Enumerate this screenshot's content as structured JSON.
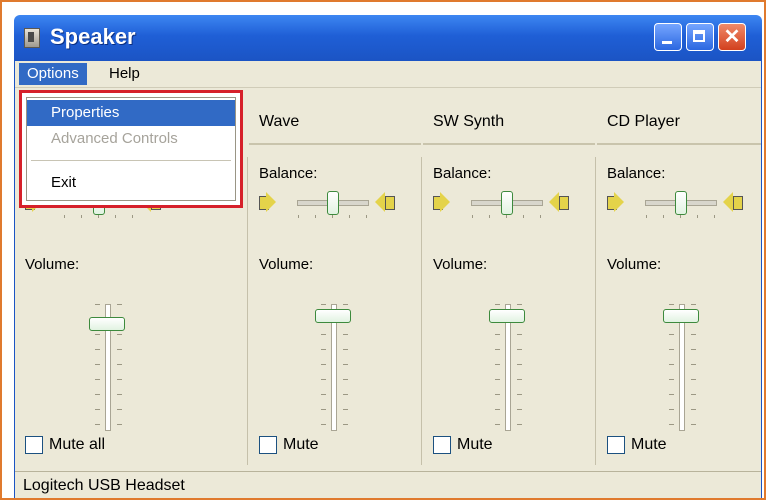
{
  "window": {
    "title": "Speaker"
  },
  "menubar": {
    "items": [
      "Options",
      "Help"
    ]
  },
  "dropdown": {
    "items": [
      {
        "label": "Properties",
        "state": "highlighted"
      },
      {
        "label": "Advanced Controls",
        "state": "disabled"
      },
      {
        "label": "Exit",
        "state": "normal"
      }
    ]
  },
  "columns": [
    {
      "title": "",
      "balance_label": "",
      "volume_label": "Volume:",
      "mute_label": "Mute all",
      "balance": 0.5,
      "volume": 0.9
    },
    {
      "title": "Wave",
      "balance_label": "Balance:",
      "volume_label": "Volume:",
      "mute_label": "Mute",
      "balance": 0.5,
      "volume": 0.96
    },
    {
      "title": "SW Synth",
      "balance_label": "Balance:",
      "volume_label": "Volume:",
      "mute_label": "Mute",
      "balance": 0.5,
      "volume": 0.96
    },
    {
      "title": "CD Player",
      "balance_label": "Balance:",
      "volume_label": "Volume:",
      "mute_label": "Mute",
      "balance": 0.5,
      "volume": 0.96
    }
  ],
  "status": {
    "text": "Logitech USB Headset"
  },
  "colors": {
    "titlebar": "#1f5fd6",
    "menu_highlight": "#316ac5",
    "callout_border": "#d6202a",
    "frame_border": "#e07a2e"
  }
}
